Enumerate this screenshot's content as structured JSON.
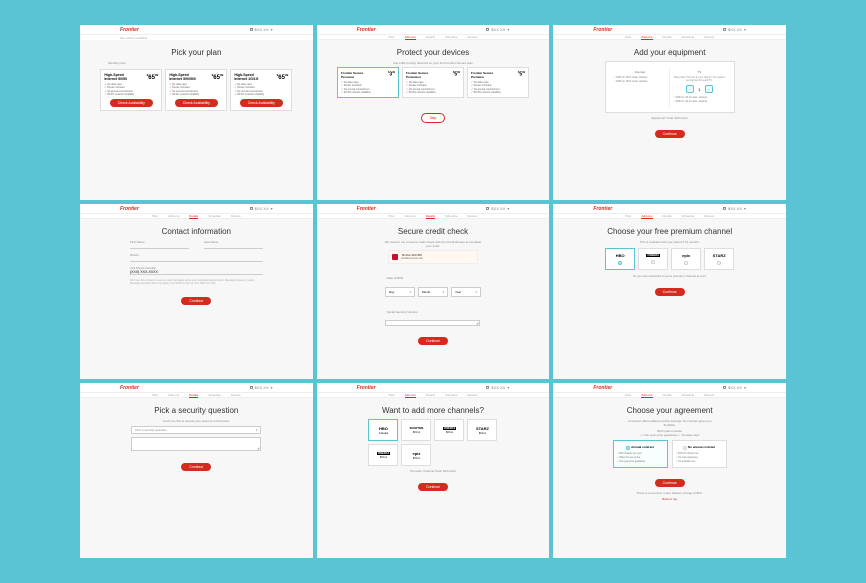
{
  "brand": "Frontier",
  "cart": "$XX.XX",
  "tabs": [
    "Plan",
    "Add-ons",
    "Details",
    "Schedule",
    "Review"
  ],
  "s1": {
    "sub": "See what's available",
    "title": "Pick your plan",
    "note": "Monthly price",
    "plans": [
      {
        "name": "High-Speed Internet 50/50",
        "price": "65",
        "sub": "/month"
      },
      {
        "name": "High-Speed Internet 500/500",
        "price": "65",
        "sub": "/month"
      },
      {
        "name": "High-Speed Internet 1G/1G",
        "price": "65",
        "sub": "/month"
      }
    ],
    "feat": [
      "No data caps",
      "Router included",
      "No annual commitment",
      "99.9% network reliability"
    ],
    "cta": "Check Availability"
  },
  "s2": {
    "title": "Protect your devices",
    "sub": "Get a $5 monthly discount on your first Frontier Secure plan",
    "tiers": [
      {
        "name": "Frontier Secure Personal",
        "p": "3"
      },
      {
        "name": "Frontier Secure Protection",
        "p": "5"
      },
      {
        "name": "Frontier Secure Premium",
        "p": "5"
      }
    ],
    "cta": "Skip"
  },
  "s3": {
    "title": "Add your equipment",
    "lcol": "Internet",
    "rcol": "TV",
    "li": "How many TVs are in your home? You need a set top box for each TV.",
    "eq": "Equipment Total: $X/month",
    "cta": "Continue",
    "item1": "DVR inc. Wi-Fi router, wireless"
  },
  "s4": {
    "title": "Contact information",
    "fn": "First Name",
    "ln": "Last Name",
    "em": "ID/Life",
    "ph": "Cell Phone Number",
    "phv": "(XXX) XXX-XXXX",
    "cta": "Continue",
    "fine": "We'll use this number to send you text messages about your installation appointment. Message frequency varies. Message and data rates may apply. Text STOP to opt out. Text HELP for help."
  },
  "s5": {
    "title": "Secure credit check",
    "sub": "We need to run a secure credit check with the Credit Bureau to complete your order.",
    "mc": "McAfee SECURE",
    "dob": "Date of Birth",
    "d": "Day",
    "m": "Month",
    "y": "Year",
    "ssn": "Social Security Number",
    "cta": "Continue"
  },
  "s6": {
    "title": "Choose your free premium channel",
    "sub": "This is included with your plan for 12 months.",
    "chans": [
      "HBO",
      "CINEMAX",
      "epix",
      "STARZ"
    ],
    "note": "Or you can subscribe to get a premium channel at cost.",
    "cta": "Continue"
  },
  "s7": {
    "title": "Pick a security question",
    "sub": "You'll use this to access your account in the future.",
    "ph": "Pick a security question",
    "cta": "Continue"
  },
  "s8": {
    "title": "Want to add more channels?",
    "chans": [
      "HBO",
      "SHOWTIME",
      "CINEMAX",
      "STARZ",
      "CINEMAX",
      "epix"
    ],
    "total": "Premium Channel Total: $X/month",
    "cta": "Continue"
  },
  "s9": {
    "title": "Choose your agreement",
    "sub": "A contract offers added monthly savings. No contract gives you flexibility.",
    "c1": "Annual contract",
    "c2": "No annual contract",
    "b": [
      "$XX cheaper per year",
      "Waive the set-up fee",
      "One year price guarantee"
    ],
    "b2": [
      "$XX/mo. Router fee",
      "No price guarantee",
      "No activation fee"
    ],
    "foot": "There is a one-time router delivery charge of $XX.",
    "cta": "Continue",
    "back": "Back to top"
  }
}
